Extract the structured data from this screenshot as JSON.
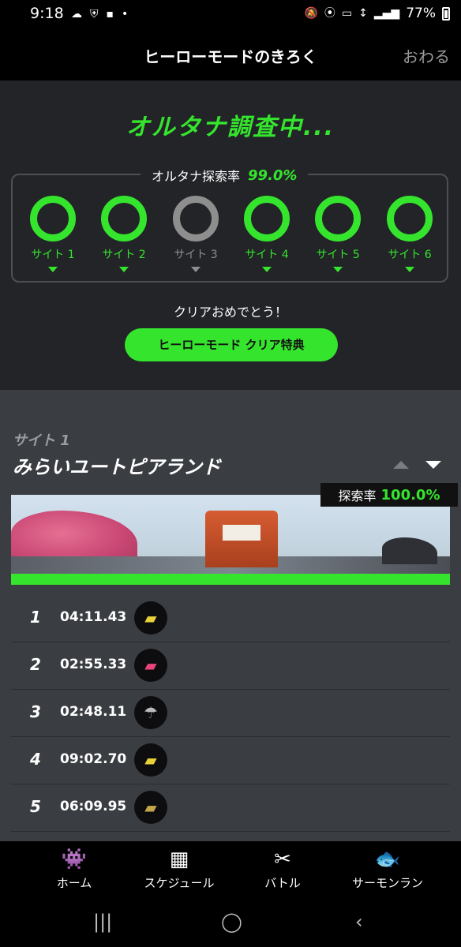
{
  "status_bar": {
    "time": "9:18",
    "left_icons": [
      "cloud-icon",
      "shield-app-icon",
      "app-badge-icon",
      "dot-icon"
    ],
    "right_icons": [
      "mute-icon",
      "location-icon",
      "volte-icon",
      "4g-icon",
      "signal-icon"
    ],
    "battery": "77%"
  },
  "app_bar": {
    "title": "ヒーローモードのきろく",
    "close": "おわる"
  },
  "summary": {
    "title": "オルタナ調査中...",
    "rate_label": "オルタナ探索率",
    "rate_value": "99.0%",
    "sites": [
      {
        "label": "サイト 1",
        "complete": true
      },
      {
        "label": "サイト 2",
        "complete": true
      },
      {
        "label": "サイト 3",
        "complete": false
      },
      {
        "label": "サイト 4",
        "complete": true
      },
      {
        "label": "サイト 5",
        "complete": true
      },
      {
        "label": "サイト 6",
        "complete": true
      }
    ],
    "congrats": "クリアおめでとう！",
    "reward_button": "ヒーローモード クリア特典"
  },
  "site_detail": {
    "site_number": "サイト 1",
    "site_name": "みらいユートピアランド",
    "rate_label": "探索率",
    "rate_value": "100.0%",
    "rows": [
      {
        "num": "1",
        "time": "04:11.43",
        "weapon": "yellow-roller-icon"
      },
      {
        "num": "2",
        "time": "02:55.33",
        "weapon": "pink-brush-icon"
      },
      {
        "num": "3",
        "time": "02:48.11",
        "weapon": "umbrella-icon"
      },
      {
        "num": "4",
        "time": "09:02.70",
        "weapon": "yellow-roller-icon"
      },
      {
        "num": "5",
        "time": "06:09.95",
        "weapon": "blaster-icon"
      }
    ]
  },
  "bottom_nav": [
    {
      "label": "ホーム",
      "icon": "squid-icon"
    },
    {
      "label": "スケジュール",
      "icon": "calendar-icon"
    },
    {
      "label": "バトル",
      "icon": "battle-icon"
    },
    {
      "label": "サーモンラン",
      "icon": "salmon-icon"
    }
  ],
  "colors": {
    "accent": "#35e52d",
    "inactive": "#8e8e8e",
    "background": "#3a3d42",
    "panel": "#222428"
  }
}
